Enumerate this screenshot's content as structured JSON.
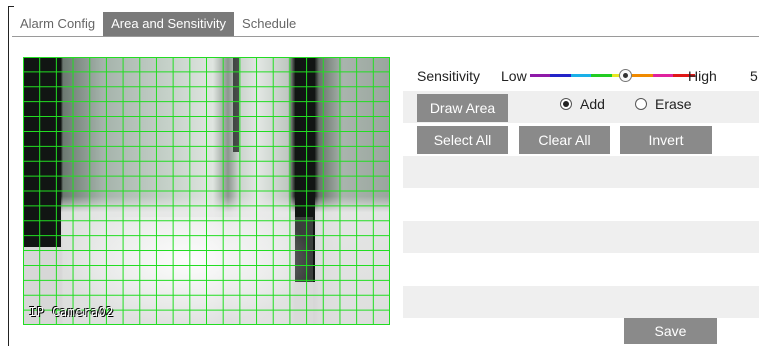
{
  "tabs": [
    {
      "label": "Alarm Config",
      "active": false
    },
    {
      "label": "Area and Sensitivity",
      "active": true
    },
    {
      "label": "Schedule",
      "active": false
    }
  ],
  "video": {
    "osd_text": "IP Camera02",
    "grid": {
      "columns": 22,
      "rows": 18,
      "color": "#22dd22"
    }
  },
  "sensitivity": {
    "label": "Sensitivity",
    "low_label": "Low",
    "high_label": "High",
    "value": "5",
    "level": 5,
    "max_level": 8,
    "segment_colors": [
      "#8e1aa8",
      "#2323c8",
      "#1ab0e8",
      "#22cc22",
      "#e8e822",
      "#f08a00",
      "#e0229e",
      "#e01818"
    ]
  },
  "actions": {
    "draw_area": "Draw Area",
    "add": "Add",
    "erase": "Erase",
    "mode_selected": "add",
    "select_all": "Select All",
    "clear_all": "Clear All",
    "invert": "Invert",
    "save": "Save"
  },
  "colors": {
    "tab_active": "#7a7a7a",
    "button": "#8a8a8a",
    "row_background": "#efefef"
  }
}
